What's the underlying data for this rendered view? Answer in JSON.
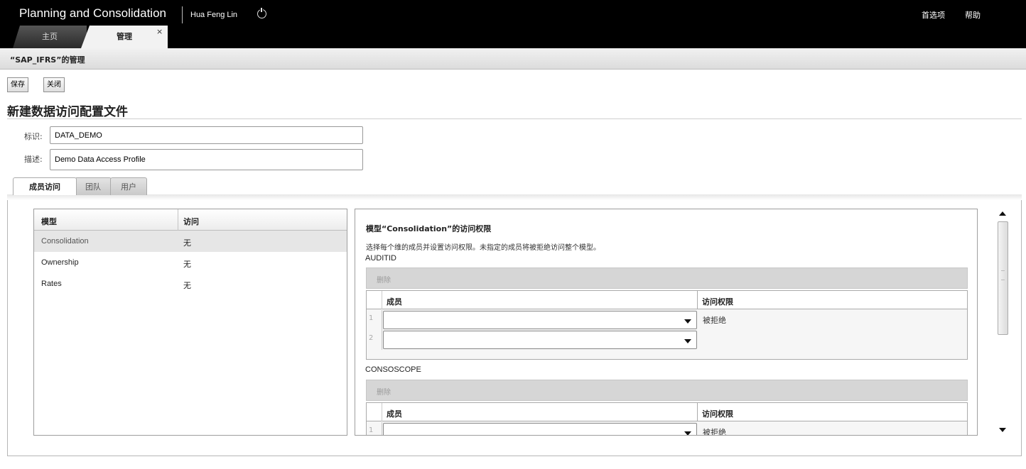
{
  "header": {
    "app_title": "Planning and Consolidation",
    "user_name": "Hua Feng Lin",
    "preferences_label": "首选项",
    "help_label": "帮助",
    "tabs": [
      {
        "label": "主页"
      },
      {
        "label": "管理",
        "close": "×"
      }
    ]
  },
  "subheader": {
    "title": "“SAP_IFRS”的管理"
  },
  "toolbar": {
    "save_label": "保存",
    "close_label": "关闭"
  },
  "page": {
    "heading": "新建数据访问配置文件"
  },
  "form": {
    "id_label": "标识:",
    "id_value": "DATA_DEMO",
    "desc_label": "描述:",
    "desc_value": "Demo Data Access Profile"
  },
  "section_tabs": [
    {
      "label": "成员访问"
    },
    {
      "label": "团队"
    },
    {
      "label": "用户"
    }
  ],
  "model_table": {
    "columns": [
      "模型",
      "访问"
    ],
    "rows": [
      {
        "model": "Consolidation",
        "access": "无",
        "selected": true
      },
      {
        "model": "Ownership",
        "access": "无",
        "selected": false
      },
      {
        "model": "Rates",
        "access": "无",
        "selected": false
      }
    ]
  },
  "access_panel": {
    "title": "模型“Consolidation”的访问权限",
    "description": "选择每个维的成员并设置访问权限。未指定的成员将被拒绝访问整个模型。",
    "dimensions": [
      {
        "name": "AUDITID",
        "delete_label": "删除",
        "columns": [
          "成员",
          "访问权限"
        ],
        "rows": [
          {
            "num": "1",
            "member": "",
            "access": "被拒绝"
          },
          {
            "num": "2",
            "member": "",
            "access": ""
          }
        ]
      },
      {
        "name": "CONSOSCOPE",
        "delete_label": "删除",
        "columns": [
          "成员",
          "访问权限"
        ],
        "rows": [
          {
            "num": "1",
            "member": "",
            "access": "被拒绝"
          }
        ]
      }
    ]
  },
  "icons": {
    "power": "power-icon",
    "close": "close-icon",
    "dropdown": "chevron-down-icon",
    "scroll_up": "scroll-up-icon",
    "scroll_down": "scroll-down-icon"
  }
}
